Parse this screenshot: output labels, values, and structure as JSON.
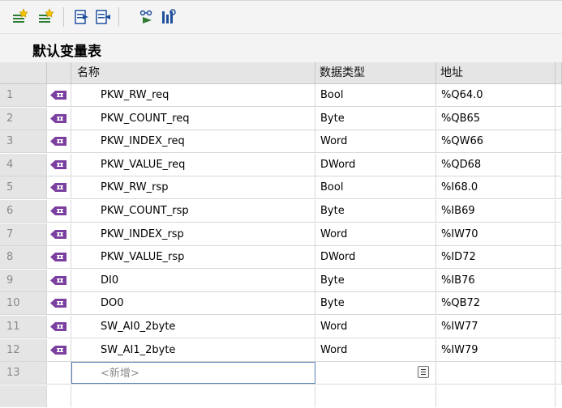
{
  "toolbar": {
    "buttons": [
      {
        "name": "add-row-icon",
        "color": "#2e7d32"
      },
      {
        "name": "insert-row-icon",
        "color": "#2e7d32"
      },
      {
        "name": "export-icon",
        "color": "#1f4e9c"
      },
      {
        "name": "import-icon",
        "color": "#1f4e9c"
      },
      {
        "name": "monitor-icon",
        "color": "#2e7d32"
      },
      {
        "name": "settings-icon",
        "color": "#1f4e9c"
      }
    ]
  },
  "table": {
    "title": "默认变量表",
    "columns": {
      "name": "名称",
      "type": "数据类型",
      "address": "地址"
    },
    "rows": [
      {
        "num": "1",
        "name": "PKW_RW_req",
        "type": "Bool",
        "address": "%Q64.0"
      },
      {
        "num": "2",
        "name": "PKW_COUNT_req",
        "type": "Byte",
        "address": "%QB65"
      },
      {
        "num": "3",
        "name": "PKW_INDEX_req",
        "type": "Word",
        "address": "%QW66"
      },
      {
        "num": "4",
        "name": "PKW_VALUE_req",
        "type": "DWord",
        "address": "%QD68"
      },
      {
        "num": "5",
        "name": "PKW_RW_rsp",
        "type": "Bool",
        "address": "%I68.0"
      },
      {
        "num": "6",
        "name": "PKW_COUNT_rsp",
        "type": "Byte",
        "address": "%IB69"
      },
      {
        "num": "7",
        "name": "PKW_INDEX_rsp",
        "type": "Word",
        "address": "%IW70"
      },
      {
        "num": "8",
        "name": "PKW_VALUE_rsp",
        "type": "DWord",
        "address": "%ID72"
      },
      {
        "num": "9",
        "name": "DI0",
        "type": "Byte",
        "address": "%IB76"
      },
      {
        "num": "10",
        "name": "DO0",
        "type": "Byte",
        "address": "%QB72"
      },
      {
        "num": "11",
        "name": "SW_AI0_2byte",
        "type": "Word",
        "address": "%IW77"
      },
      {
        "num": "12",
        "name": "SW_AI1_2byte",
        "type": "Word",
        "address": "%IW79"
      }
    ],
    "new_row": {
      "num": "13",
      "placeholder": "<新增>"
    },
    "tag_icon_color": "#7b3fa0"
  }
}
